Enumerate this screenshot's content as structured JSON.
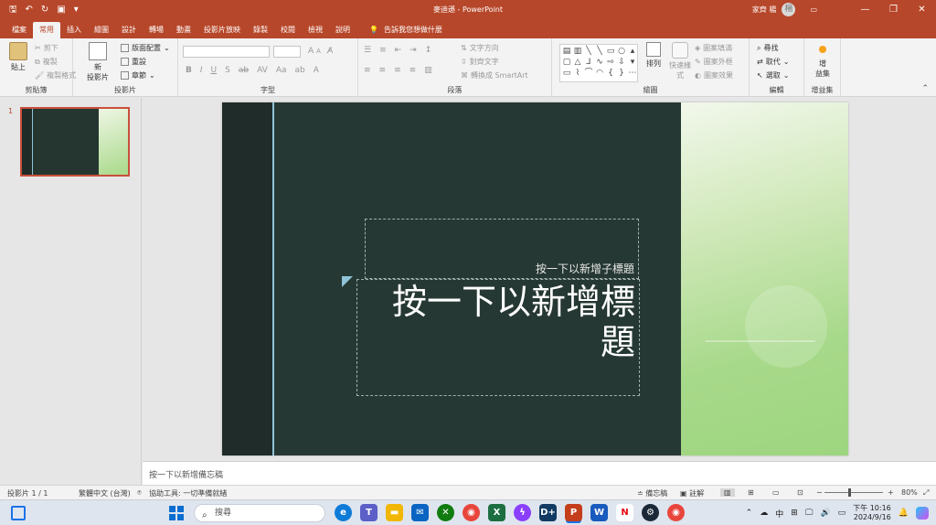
{
  "titlebar": {
    "title": "麥迪遜 - PowerPoint",
    "user_name": "家齊 楊",
    "user_initial": "楊",
    "accent": "#b7472a"
  },
  "tabs": {
    "items": [
      "檔案",
      "常用",
      "插入",
      "繪圖",
      "設計",
      "轉場",
      "動畫",
      "投影片放映",
      "錄製",
      "校閱",
      "檢視",
      "說明"
    ],
    "tell_me": "告訴我您想做什麼"
  },
  "ribbon": {
    "clipboard": {
      "label": "剪貼簿",
      "paste": "貼上",
      "cut": "剪下",
      "copy": "複製",
      "format_painter": "複製格式"
    },
    "slides": {
      "label": "投影片",
      "new_slide_1": "新",
      "new_slide_2": "投影片",
      "layout": "版面配置",
      "reset": "重設",
      "section": "章節"
    },
    "font": {
      "label": "字型",
      "bold": "B",
      "italic": "I",
      "underline": "U",
      "strike": "S",
      "aa": "Aa",
      "grow": "A",
      "shrink": "A"
    },
    "paragraph": {
      "label": "段落",
      "text_direction": "文字方向",
      "align_text": "對齊文字",
      "smartart": "轉換成 SmartArt"
    },
    "drawing": {
      "label": "繪圖",
      "arrange": "排列",
      "quick_styles_1": "快速樣",
      "quick_styles_2": "式",
      "shape_fill": "圖案填滿",
      "shape_outline": "圖案外框",
      "shape_effects": "圖案效果"
    },
    "editing": {
      "label": "編輯",
      "find": "尋找",
      "replace": "取代",
      "select": "選取"
    },
    "addins": {
      "label": "增益集",
      "addins_1": "增",
      "addins_2": "益集"
    }
  },
  "thumbnails": {
    "slide_number": "1"
  },
  "slide": {
    "subtitle_placeholder": "按一下以新增子標題",
    "title_placeholder": "按一下以新增標題"
  },
  "notes": {
    "placeholder": "按一下以新增備忘稿"
  },
  "statusbar": {
    "slide_info": "投影片 1 / 1",
    "language": "繁體中文 (台灣)",
    "accessibility": "協助工具: 一切準備就緒",
    "notes_btn": "備忘稿",
    "comments_btn": "註解",
    "zoom": "80%"
  },
  "taskbar": {
    "search_placeholder": "搜尋",
    "ime": "中",
    "time": "下午 10:16",
    "date": "2024/9/16"
  }
}
